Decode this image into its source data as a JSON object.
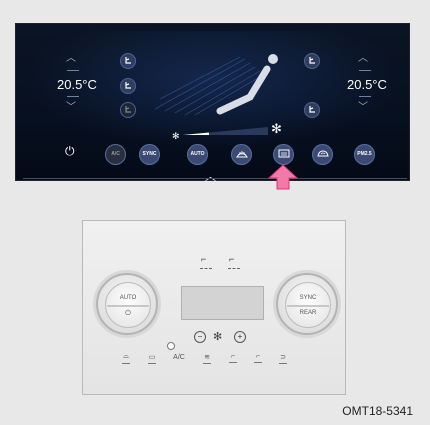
{
  "screen": {
    "temp_left": "20.5°C",
    "temp_right": "20.5°C",
    "buttons": [
      {
        "id": "power",
        "label": ""
      },
      {
        "id": "ac",
        "label": "A/C"
      },
      {
        "id": "sync",
        "label": "SYNC"
      },
      {
        "id": "auto",
        "label": "AUTO"
      },
      {
        "id": "max-defrost",
        "label": ""
      },
      {
        "id": "rear-defrost",
        "label": ""
      },
      {
        "id": "recirculation",
        "label": ""
      },
      {
        "id": "pm25",
        "label": "PM2.5"
      }
    ],
    "fan_level": 0.3
  },
  "panel": {
    "left_knob": {
      "label_top": "AUTO",
      "label_bottom": "⏻"
    },
    "right_knob": {
      "label_top": "SYNC",
      "label_bottom": "REAR"
    },
    "ac_label": "A/C"
  },
  "caption": "OMT18-5341",
  "colors": {
    "screen_bg": "#0b1424",
    "button_bg": "#3a4a74",
    "arrow": "#e0347e",
    "panel_bg": "#ececec"
  }
}
